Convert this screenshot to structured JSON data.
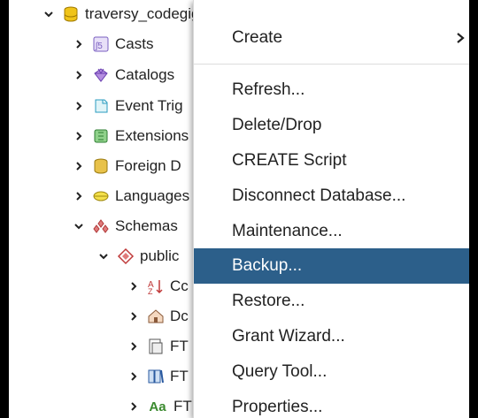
{
  "tree": {
    "database": {
      "label": "traversy_codegig",
      "icon": "database-icon"
    },
    "items": [
      {
        "label": "Casts",
        "icon": "casts-icon"
      },
      {
        "label": "Catalogs",
        "icon": "catalogs-icon"
      },
      {
        "label": "Event Trig",
        "icon": "event-trigger-icon"
      },
      {
        "label": "Extensions",
        "icon": "extensions-icon"
      },
      {
        "label": "Foreign D",
        "icon": "foreign-data-icon"
      },
      {
        "label": "Languages",
        "icon": "languages-icon"
      },
      {
        "label": "Schemas",
        "icon": "schemas-icon"
      }
    ],
    "schema_public": {
      "label": "public",
      "icon": "schema-icon"
    },
    "public_children": [
      {
        "label": "Cc",
        "icon": "collations-icon"
      },
      {
        "label": "Dc",
        "icon": "domains-icon"
      },
      {
        "label": "FT",
        "icon": "fts-configurations-icon"
      },
      {
        "label": "FT",
        "icon": "fts-dictionaries-icon"
      },
      {
        "label": "FT",
        "icon_text": "Aa",
        "icon": "fts-parsers-icon"
      }
    ]
  },
  "context_menu": {
    "items": [
      {
        "label": "Create",
        "has_submenu": true
      },
      {
        "label": "Refresh..."
      },
      {
        "label": "Delete/Drop"
      },
      {
        "label": "CREATE Script"
      },
      {
        "label": "Disconnect Database..."
      },
      {
        "label": "Maintenance..."
      },
      {
        "label": "Backup...",
        "highlighted": true
      },
      {
        "label": "Restore..."
      },
      {
        "label": "Grant Wizard..."
      },
      {
        "label": "Query Tool..."
      },
      {
        "label": "Properties..."
      }
    ],
    "highlight_color": "#2c5f8a"
  }
}
